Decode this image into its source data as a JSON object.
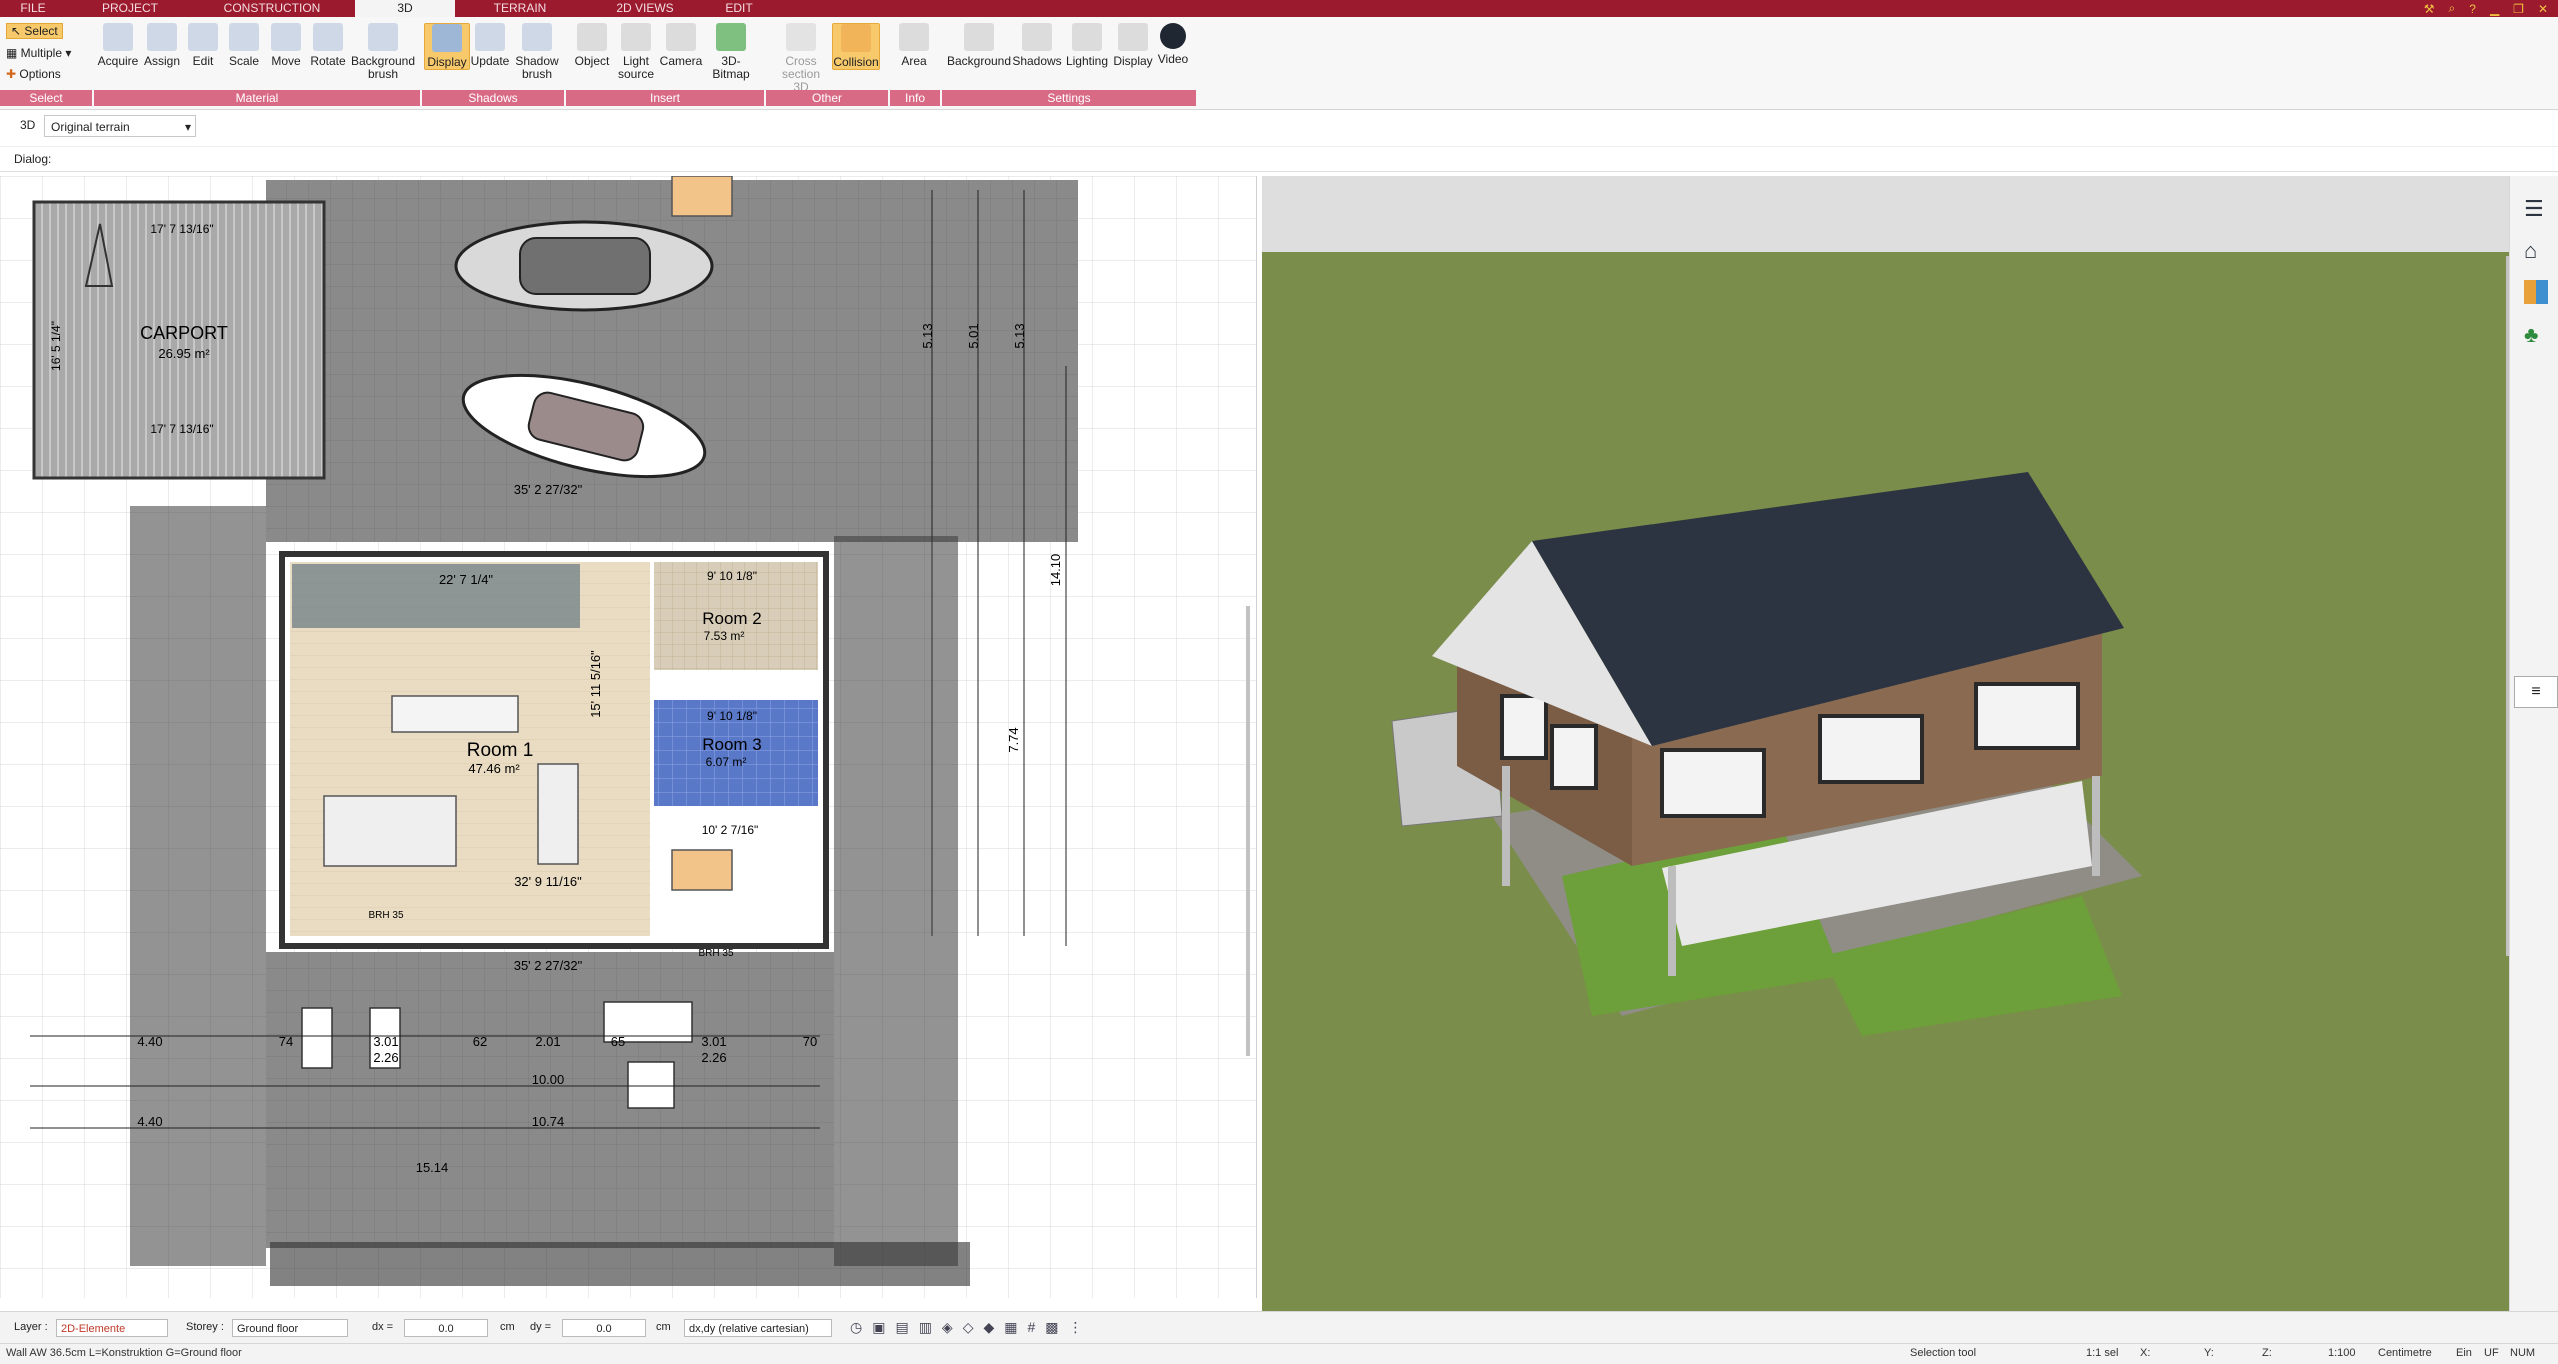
{
  "menu": {
    "tabs": [
      "FILE",
      "PROJECT",
      "CONSTRUCTION",
      "3D",
      "TERRAIN",
      "2D VIEWS",
      "EDIT"
    ],
    "active": "3D"
  },
  "ribbon": {
    "select": {
      "select": "Select",
      "multiple": "Multiple",
      "options": "Options"
    },
    "buttons": {
      "acquire": "Acquire",
      "assign": "Assign",
      "edit": "Edit",
      "scale": "Scale",
      "move": "Move",
      "rotate": "Rotate",
      "background_brush": "Background brush",
      "display": "Display",
      "update": "Update",
      "shadow_brush": "Shadow brush",
      "object": "Object",
      "light_source": "Light source",
      "camera": "Camera",
      "bitmap_3d": "3D-Bitmap",
      "cross_section": "Cross section 3D",
      "collision": "Collision",
      "area": "Area",
      "background": "Background",
      "shadows": "Shadows",
      "lighting": "Lighting",
      "display2": "Display",
      "video": "Video"
    },
    "groups": {
      "select": "Select",
      "material": "Material",
      "shadows": "Shadows",
      "insert": "Insert",
      "other": "Other",
      "info": "Info",
      "settings": "Settings"
    }
  },
  "toolbar": {
    "mode": "3D",
    "terrain": "Original terrain",
    "dialog_label": "Dialog:"
  },
  "plan": {
    "carport": {
      "name": "CARPORT",
      "area": "26.95 m²",
      "dim_top": "17' 7 13/16\"",
      "dim_bottom": "17' 7 13/16\"",
      "dim_side": "16' 5 1/4\""
    },
    "room1": {
      "name": "Room 1",
      "area": "47.46 m²"
    },
    "room2": {
      "name": "Room 2",
      "area": "7.53 m²"
    },
    "room3": {
      "name": "Room 3",
      "area": "6.07 m²"
    },
    "dims": {
      "top_width": "35' 2 27/32\"",
      "bottom_width": "35' 2 27/32\"",
      "stairs": "22' 7 1/4\"",
      "room1_width": "32' 9 11/16\"",
      "room1_height": "15' 11 5/16\"",
      "room2_top": "9' 10 1/8\"",
      "room3_top": "9' 10 1/8\"",
      "room_south": "10' 2 7/16\"",
      "d1": "10.00",
      "d2": "10.74",
      "d3": "15.14",
      "v1": "5.13",
      "v2": "5.01",
      "v3": "5.13",
      "v4": "14.10",
      "v5": "7.74",
      "w1": "3.01",
      "w2": "2.26",
      "w3": "2.01",
      "w4": "3.01",
      "w5": "2.26",
      "w6": "74",
      "w7": "62",
      "w8": "65",
      "w9": "70",
      "l1": "4.40",
      "l2": "4.40",
      "brh": "BRH 35"
    }
  },
  "bottom": {
    "layer_label": "Layer :",
    "layer_value": "2D-Elemente",
    "storey_label": "Storey :",
    "storey_value": "Ground floor",
    "dx_label": "dx =",
    "dx_value": "0.0",
    "dy_label": "dy =",
    "dy_value": "0.0",
    "unit": "cm",
    "coord_mode": "dx,dy (relative cartesian)"
  },
  "status": {
    "left": "Wall AW 36.5cm L=Konstruktion G=Ground floor",
    "tool": "Selection tool",
    "scale_sel": "1:1 sel",
    "x": "X:",
    "y": "Y:",
    "z": "Z:",
    "scale": "1:100",
    "unit": "Centimetre",
    "ein": "Ein",
    "uf": "UF",
    "num": "NUM"
  },
  "colors": {
    "menubar": "#9b1a2e",
    "group": "#d96a86",
    "grass": "#7a8d4a",
    "roof": "#2b3440"
  }
}
